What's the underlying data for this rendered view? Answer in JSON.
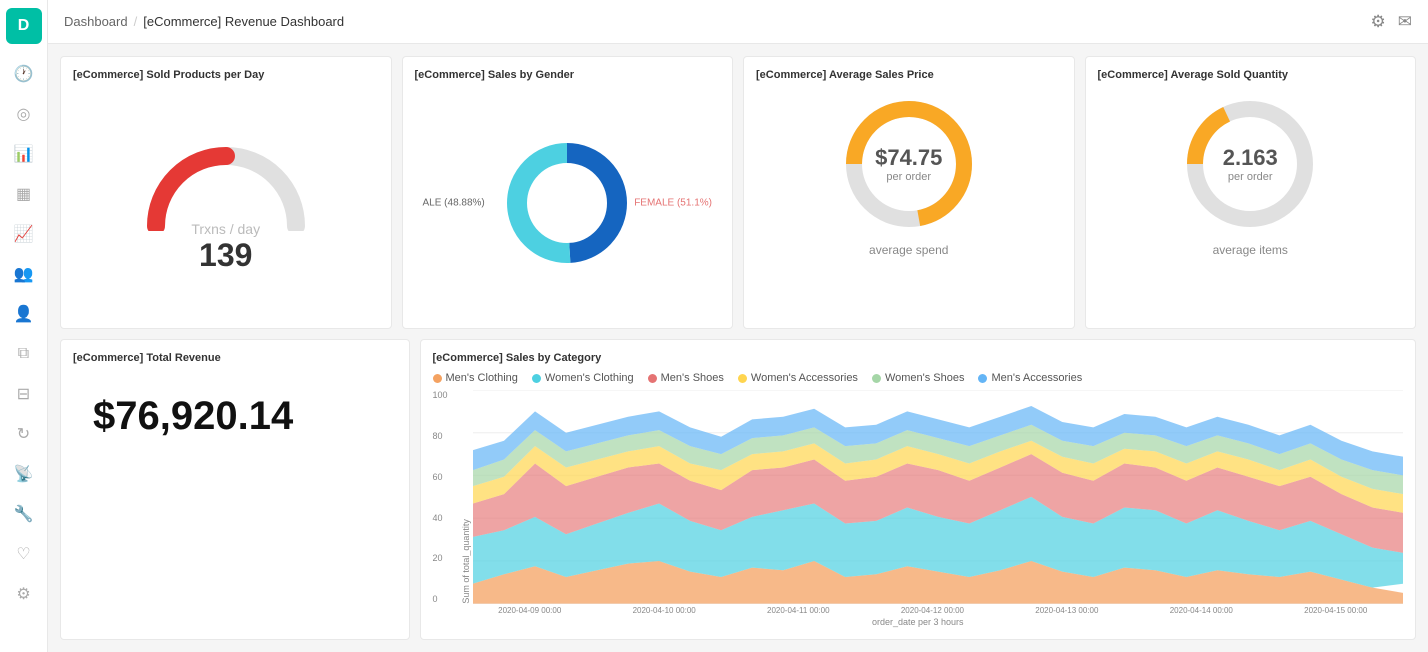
{
  "sidebar": {
    "logo": "D",
    "icons": [
      "clock",
      "compass",
      "bar-chart",
      "table",
      "chart-bar-alt",
      "user-group",
      "user",
      "layers",
      "filter",
      "refresh",
      "broadcast",
      "wrench",
      "heart",
      "gear"
    ]
  },
  "header": {
    "breadcrumb_home": "Dashboard",
    "breadcrumb_current": "[eCommerce] Revenue Dashboard",
    "icon_settings": "⚙",
    "icon_mail": "✉"
  },
  "cards": {
    "sold_per_day": {
      "title": "[eCommerce] Sold Products per Day",
      "subtitle": "Trxns / day",
      "value": "139",
      "gauge_percent": 0.42
    },
    "sales_by_gender": {
      "title": "[eCommerce] Sales by Gender",
      "male_label": "ALE (48.88%)",
      "female_label": "FEMALE (51.1%)",
      "male_pct": 0.4888,
      "female_pct": 0.5112
    },
    "avg_sales_price": {
      "title": "[eCommerce] Average Sales Price",
      "main_value": "$74.75",
      "sub_value": "per order",
      "footer": "average spend",
      "fill_pct": 0.72
    },
    "avg_sold_qty": {
      "title": "[eCommerce] Average Sold Quantity",
      "main_value": "2.163",
      "sub_value": "per order",
      "footer": "average items",
      "fill_pct": 0.18
    },
    "total_revenue": {
      "title": "[eCommerce] Total Revenue",
      "value": "$76,920.14"
    },
    "sales_by_category": {
      "title": "[eCommerce] Sales by Category",
      "legend": [
        {
          "label": "Men's Clothing",
          "color": "#F4A261"
        },
        {
          "label": "Women's Clothing",
          "color": "#4DD0E1"
        },
        {
          "label": "Men's Shoes",
          "color": "#E57373"
        },
        {
          "label": "Women's Accessories",
          "color": "#FFD54F"
        },
        {
          "label": "Women's Shoes",
          "color": "#A5D6A7"
        },
        {
          "label": "Men's Accessories",
          "color": "#64B5F6"
        }
      ],
      "y_axis_label": "Sum of total_quantity",
      "x_axis_label": "order_date per 3 hours",
      "y_ticks": [
        "0",
        "20",
        "40",
        "60",
        "80",
        "100"
      ],
      "x_ticks": [
        "2020-04-09 00:00",
        "2020-04-10 00:00",
        "2020-04-11 00:00",
        "2020-04-12 00:00",
        "2020-04-13 00:00",
        "2020-04-14 00:00",
        "2020-04-15 00:00"
      ]
    }
  }
}
